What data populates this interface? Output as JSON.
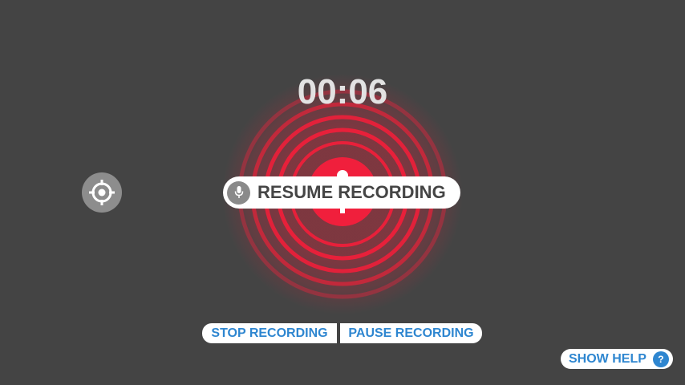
{
  "recorder": {
    "timer": "00:06",
    "resume_label": "RESUME RECORDING",
    "stop_label": "STOP RECORDING",
    "pause_label": "PAUSE RECORDING",
    "help_label": "SHOW HELP",
    "help_glyph": "?"
  },
  "icons": {
    "locate": "crosshair-icon",
    "mic": "microphone-icon",
    "help": "question-icon"
  },
  "colors": {
    "background": "#444444",
    "record_red": "#e8203a",
    "accent_blue": "#2e86d0",
    "timer_text": "#e2e2e2"
  }
}
